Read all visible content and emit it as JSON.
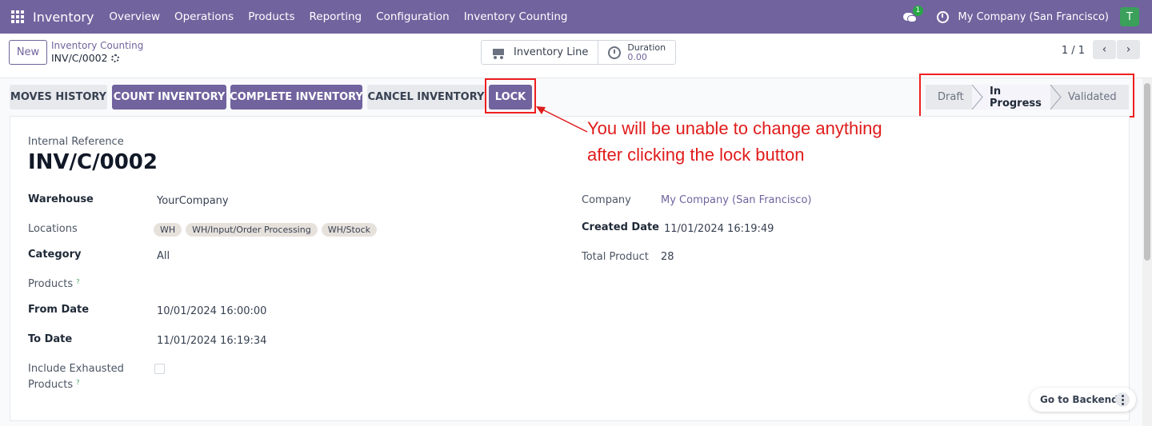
{
  "navbar": {
    "brand": "Inventory",
    "menu": [
      "Overview",
      "Operations",
      "Products",
      "Reporting",
      "Configuration",
      "Inventory Counting"
    ],
    "chat_badge": "1",
    "company": "My Company (San Francisco)",
    "avatar_letter": "T"
  },
  "control_panel": {
    "new_label": "New",
    "breadcrumb_parent": "Inventory Counting",
    "breadcrumb_current": "INV/C/0002",
    "smart_buttons": {
      "inventory_line": "Inventory Line",
      "duration_label": "Duration",
      "duration_value": "0.00"
    },
    "pager": "1 / 1",
    "prev_icon": "‹",
    "next_icon": "›"
  },
  "actions": {
    "moves_history": "MOVES HISTORY",
    "count_inventory": "COUNT INVENTORY",
    "complete_inventory": "COMPLETE INVENTORY",
    "cancel_inventory": "CANCEL INVENTORY",
    "lock": "LOCK"
  },
  "stages": [
    "Draft",
    "In Progress",
    "Validated"
  ],
  "active_stage": "In Progress",
  "form": {
    "internal_reference_label": "Internal Reference",
    "record_name": "INV/C/0002",
    "warehouse_label": "Warehouse",
    "warehouse_value": "YourCompany",
    "locations_label": "Locations",
    "locations": [
      "WH",
      "WH/Input/Order Processing",
      "WH/Stock"
    ],
    "category_label": "Category",
    "category_value": "All",
    "products_label": "Products",
    "from_date_label": "From Date",
    "from_date_value": "10/01/2024 16:00:00",
    "to_date_label": "To Date",
    "to_date_value": "11/01/2024 16:19:34",
    "include_exhausted_label_1": "Include Exhausted",
    "include_exhausted_label_2": "Products",
    "include_exhausted_checked": false,
    "help_mark": "?",
    "company_label": "Company",
    "company_value": "My Company (San Francisco)",
    "created_date_label": "Created Date",
    "created_date_value": "11/01/2024 16:19:49",
    "total_product_label": "Total Product",
    "total_product_value": "28"
  },
  "annotation": {
    "line1": "You will be unable to change anything",
    "line2": "after clicking the lock button",
    "color": "#e01b1b"
  },
  "floating": {
    "go_to_backend": "Go to Backend"
  },
  "colors": {
    "brand": "#71639e",
    "annotation_red": "#ef1f1f"
  }
}
